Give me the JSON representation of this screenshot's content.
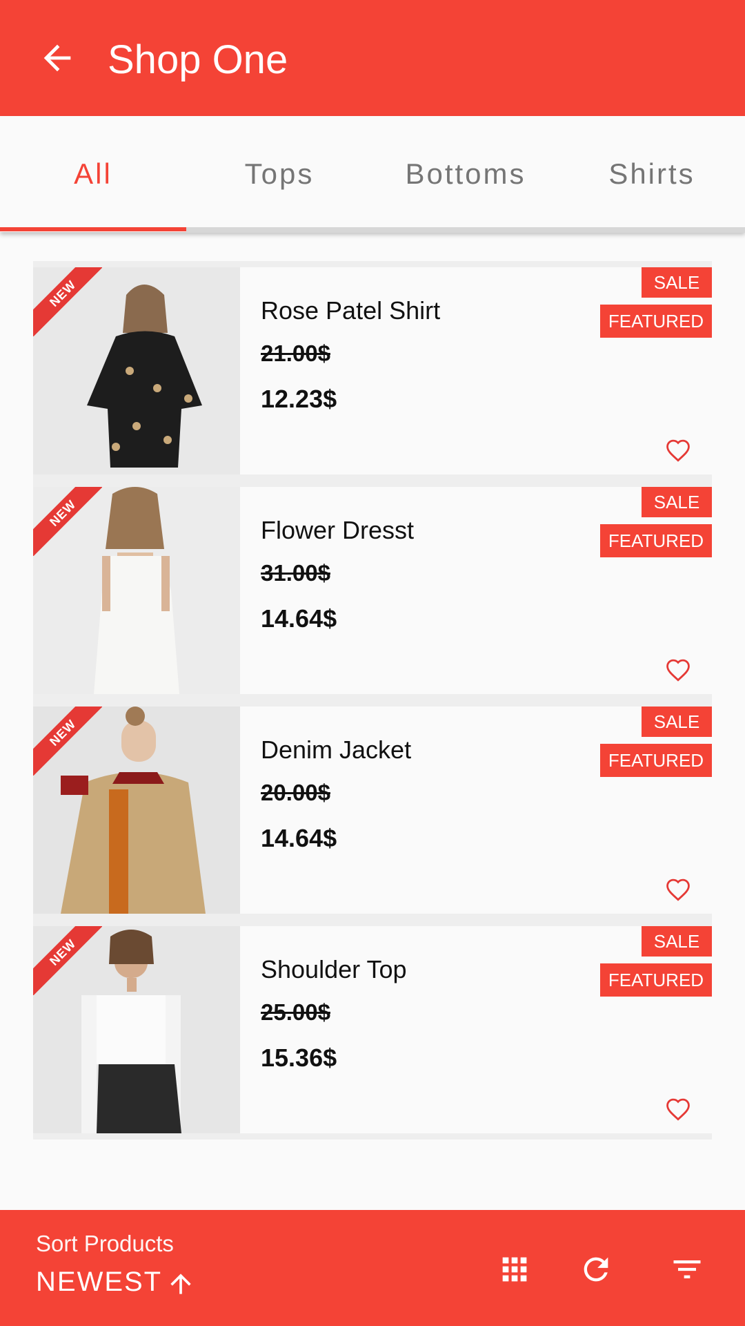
{
  "app_bar": {
    "title": "Shop One",
    "back_icon": "arrow-back-icon"
  },
  "tabs": [
    {
      "label": "All",
      "active": true
    },
    {
      "label": "Tops",
      "active": false
    },
    {
      "label": "Bottoms",
      "active": false
    },
    {
      "label": "Shirts",
      "active": false
    }
  ],
  "products": [
    {
      "name": "Rose Patel Shirt",
      "old_price": "21.00$",
      "new_price": "12.23$",
      "ribbon": "NEW",
      "sale": "SALE",
      "featured": "FEATURED"
    },
    {
      "name": "Flower Dresst",
      "old_price": "31.00$",
      "new_price": "14.64$",
      "ribbon": "NEW",
      "sale": "SALE",
      "featured": "FEATURED"
    },
    {
      "name": "Denim Jacket",
      "old_price": "20.00$",
      "new_price": "14.64$",
      "ribbon": "NEW",
      "sale": "SALE",
      "featured": "FEATURED"
    },
    {
      "name": "Shoulder Top",
      "old_price": "25.00$",
      "new_price": "15.36$",
      "ribbon": "NEW",
      "sale": "SALE",
      "featured": "FEATURED"
    }
  ],
  "bottom_bar": {
    "sort_label": "Sort Products",
    "sort_value": "NEWEST",
    "icons": [
      "arrow-up-icon",
      "grid-view-icon",
      "refresh-icon",
      "filter-icon"
    ]
  },
  "colors": {
    "accent": "#f44336",
    "tab_inactive": "#757575",
    "background": "#fafafa"
  }
}
